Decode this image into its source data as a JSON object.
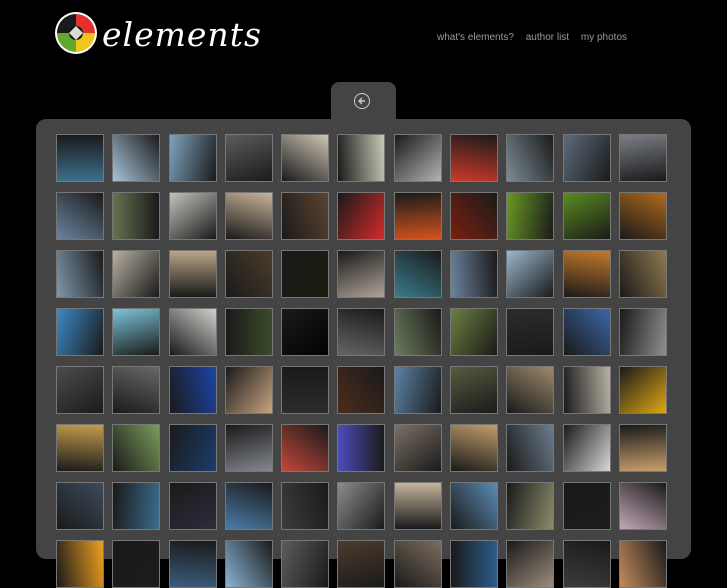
{
  "logo": {
    "text": "elements"
  },
  "nav": {
    "items": [
      "what's elements?",
      "author list",
      "my photos"
    ]
  },
  "colors": {
    "logo_red": "#e2302b",
    "logo_green": "#64a72f",
    "logo_yellow": "#f0c51c"
  },
  "grid": {
    "photos": [
      [
        "#3c6f8c",
        "#a8c4da",
        "#7ea4bf",
        "#5c5c5c",
        "#cfc6b5",
        "#c8c8b5",
        "#b4b4b4",
        "#cc3a2a",
        "#7c8c96",
        "#5c6c7c",
        "#7b7f85"
      ],
      [
        "#6c84a0",
        "#647250",
        "#c4c4bd",
        "#c9b39a",
        "#5c4430",
        "#d32a2a",
        "#d2541d",
        "#7a2010",
        "#6a9a24",
        "#5a8c20",
        "#b06a1c"
      ],
      [
        "#7f98ad",
        "#b8b0a2",
        "#b8a586",
        "#4a3c2c",
        "#1c1c10",
        "#b0a498",
        "#3a7c8c",
        "#6c849e",
        "#9ab8cf",
        "#c57a2a",
        "#8f7a50"
      ],
      [
        "#3c8ac7",
        "#7cc4d8",
        "#d1d0cc",
        "#3c4a2c",
        "#020202",
        "#656565",
        "#6c7c5c",
        "#6c8040",
        "#2c2c2c",
        "#3c66a8",
        "#8f8f8f"
      ],
      [
        "#4c4c4c",
        "#686868",
        "#1c44a8",
        "#c8a480",
        "#2c2c2c",
        "#4c2c1c",
        "#5c82a7",
        "#585a40",
        "#9c8a6c",
        "#b7b2a4",
        "#e0a814"
      ],
      [
        "#c49c4c",
        "#7c9c5c",
        "#1c3c6c",
        "#84888e",
        "#c2473a",
        "#4c4cbc",
        "#7c7066",
        "#c29d6c",
        "#6b7c8c",
        "#d8d8d8",
        "#c8a06c"
      ],
      [
        "#3c4c5c",
        "#3c6c8c",
        "#2c2c3c",
        "#4c7ca8",
        "#3c3c3c",
        "#8c8c8c",
        "#c4b49c",
        "#5c8cb4",
        "#8c8c6c",
        "#1c1c1c",
        "#c4a8b8"
      ],
      [
        "#f0a020",
        "#1c1c1c",
        "#3c5c7c",
        "#8ab4d4",
        "#5c5c5c",
        "#4c3c2c",
        "#7c6c5c",
        "#2c5c8c",
        "#9c8c7c",
        "#3c3c3c",
        "#c48c5c"
      ]
    ]
  }
}
